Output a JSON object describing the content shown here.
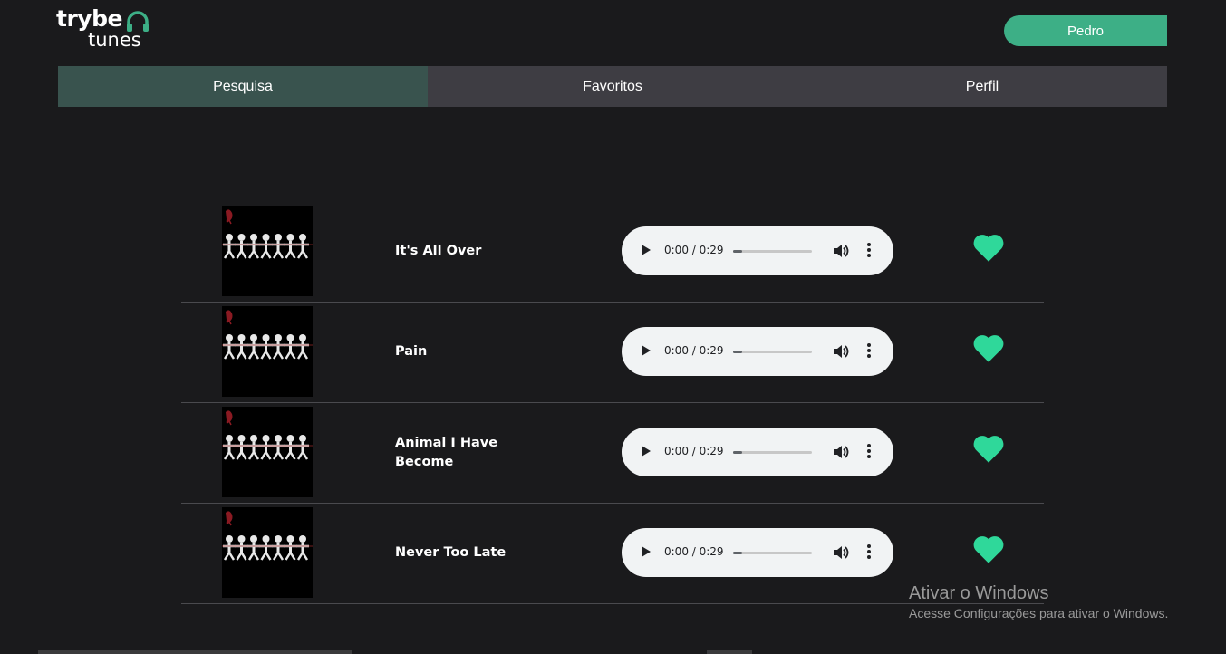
{
  "logo": {
    "line1": "trybe",
    "line2": "tunes"
  },
  "header": {
    "user_name": "Pedro"
  },
  "tabs": [
    {
      "label": "Pesquisa",
      "active": true
    },
    {
      "label": "Favoritos",
      "active": false
    },
    {
      "label": "Perfil",
      "active": false
    }
  ],
  "tracks": [
    {
      "title": "It's All Over",
      "time": "0:00 / 0:29",
      "favorite": true
    },
    {
      "title": "Pain",
      "time": "0:00 / 0:29",
      "favorite": true
    },
    {
      "title": "Animal I Have Become",
      "time": "0:00 / 0:29",
      "favorite": true
    },
    {
      "title": "Never Too Late",
      "time": "0:00 / 0:29",
      "favorite": true
    }
  ],
  "watermark": {
    "title": "Ativar o Windows",
    "subtitle": "Acesse Configurações para ativar o Windows."
  },
  "colors": {
    "accent": "#3daf86",
    "heart": "#2fd89a",
    "tab_active": "#39534e",
    "tab": "#3e3d43",
    "background": "#1a1a1c"
  }
}
